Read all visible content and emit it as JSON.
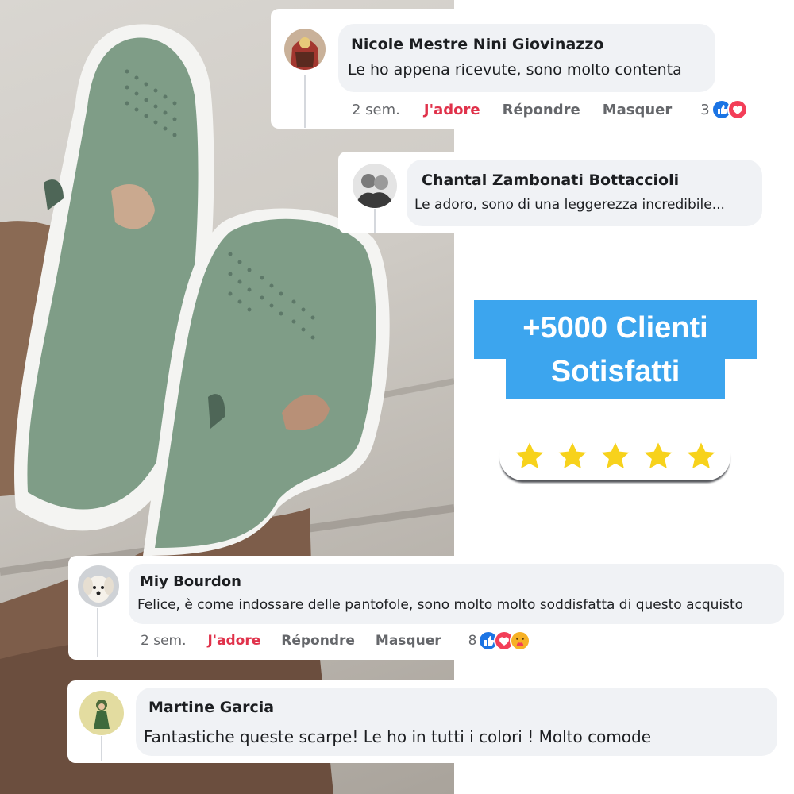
{
  "promo": {
    "line1": "+5000 Clienti",
    "line2": "Sotisfatti",
    "rating_stars": 5
  },
  "comments": [
    {
      "author": "Nicole Mestre Nini Giovinazzo",
      "text": "Le ho appena ricevute, sono molto contenta",
      "time": "2 sem.",
      "love_label": "J'adore",
      "reply_label": "Répondre",
      "hide_label": "Masquer",
      "reaction_count": "3",
      "reactions": [
        "like-icon",
        "love-icon"
      ]
    },
    {
      "author": "Chantal Zambonati Bottaccioli",
      "text": "Le adoro, sono di una leggerezza incredibile..."
    },
    {
      "author": "Miy Bourdon",
      "text": "Felice, è come indossare delle pantofole, sono molto molto soddisfatta di questo acquisto",
      "time": "2 sem.",
      "love_label": "J'adore",
      "reply_label": "Répondre",
      "hide_label": "Masquer",
      "reaction_count": "8",
      "reactions": [
        "like-icon",
        "love-icon",
        "care-icon"
      ]
    },
    {
      "author": "Martine Garcia",
      "text": "Fantastiche queste scarpe! Le ho in tutti i colori ! Molto comode"
    }
  ],
  "colors": {
    "brand_blue": "#3ca5ee",
    "love_red": "#e0324b",
    "star_yellow": "#f7d21c",
    "shoe_green": "#7f9d87",
    "bubble_gray": "#f0f2f5"
  }
}
